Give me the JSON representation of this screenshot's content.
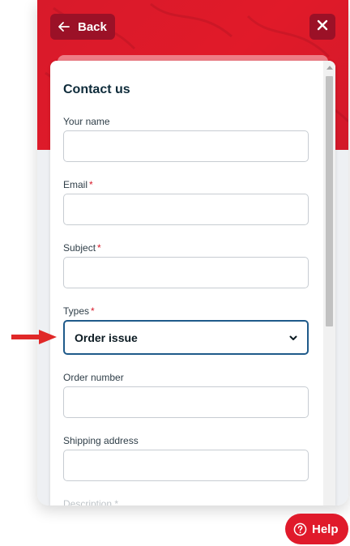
{
  "header": {
    "back_label": "Back",
    "back_icon": "arrow-left-icon",
    "close_icon": "close-icon"
  },
  "form": {
    "title": "Contact us",
    "fields": {
      "name": {
        "label": "Your name",
        "value": ""
      },
      "email": {
        "label": "Email",
        "required_mark": "*",
        "value": ""
      },
      "subject": {
        "label": "Subject",
        "required_mark": "*",
        "value": ""
      },
      "types": {
        "label": "Types",
        "required_mark": "*",
        "selected": "Order issue"
      },
      "order_number": {
        "label": "Order number",
        "value": ""
      },
      "shipping_address": {
        "label": "Shipping address",
        "value": ""
      },
      "description": {
        "label": "Description",
        "required_mark": "*"
      }
    }
  },
  "help": {
    "label": "Help",
    "icon": "question-circle-icon"
  },
  "colors": {
    "brand_red": "#e11a29",
    "dark_red": "#9b1127",
    "focus_blue": "#1f5a8a",
    "arrow_red": "#e02828"
  }
}
